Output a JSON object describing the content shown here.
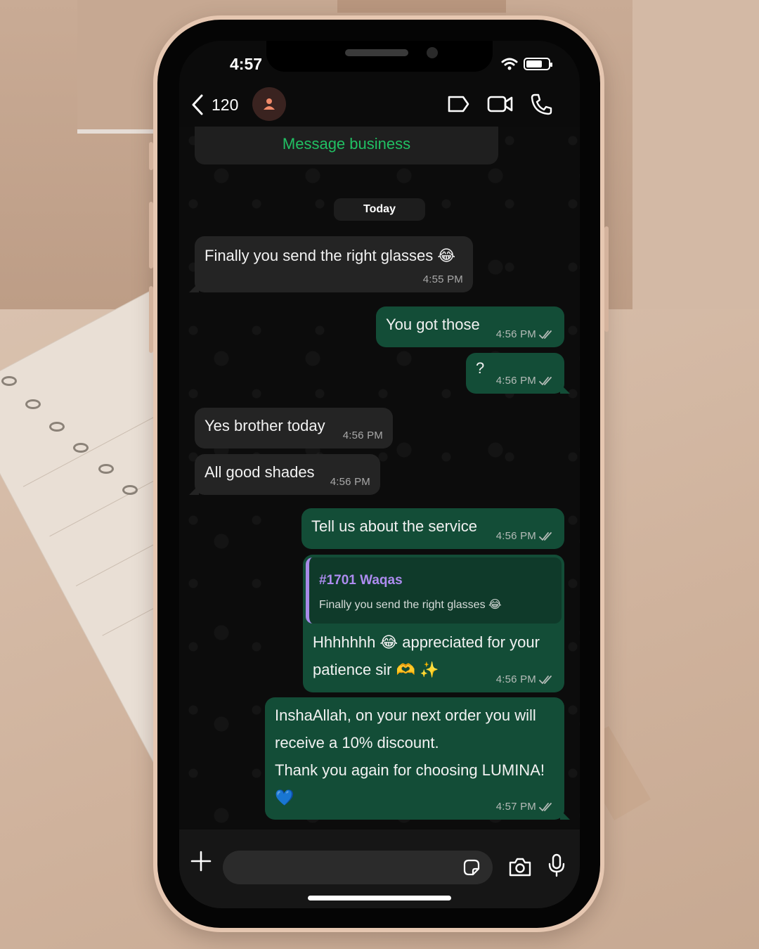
{
  "status_bar": {
    "time": "4:57"
  },
  "header": {
    "back_count": "120",
    "icons": [
      "chevron-left-icon",
      "person-icon",
      "label-icon",
      "video-call-icon",
      "phone-icon"
    ]
  },
  "business_card": {
    "link_label": "Message business"
  },
  "day_divider": "Today",
  "messages": [
    {
      "direction": "in",
      "text": "Finally you send the right glasses 😂",
      "time": "4:55 PM"
    },
    {
      "direction": "out",
      "text": "You got those",
      "time": "4:56 PM",
      "ticks": "read"
    },
    {
      "direction": "out",
      "text": "?",
      "time": "4:56 PM",
      "ticks": "read"
    },
    {
      "direction": "in",
      "text": "Yes brother today",
      "time": "4:56 PM"
    },
    {
      "direction": "in",
      "text": "All good shades",
      "time": "4:56 PM"
    },
    {
      "direction": "out",
      "text": "Tell us about the service",
      "time": "4:56 PM",
      "ticks": "read"
    },
    {
      "direction": "out",
      "quote_author": "#1701 Waqas",
      "quote_text": "Finally you send the right glasses 😂",
      "line1": "Hhhhhhh 😂 appreciated for your",
      "line2": "patience sir 🫶 ✨",
      "time": "4:56 PM",
      "ticks": "read"
    },
    {
      "direction": "out",
      "line1": "InshaAllah, on your next order you will",
      "line2": "receive a 10% discount.",
      "line3": "Thank you again for choosing LUMINA!",
      "line4": "💙",
      "time": "4:57 PM",
      "ticks": "read"
    }
  ],
  "composer": {
    "placeholder": ""
  },
  "colors": {
    "incoming_bubble": "#242424",
    "outgoing_bubble": "#134d37",
    "accent_green": "#21c063",
    "quote_accent": "#ad8cf0"
  }
}
